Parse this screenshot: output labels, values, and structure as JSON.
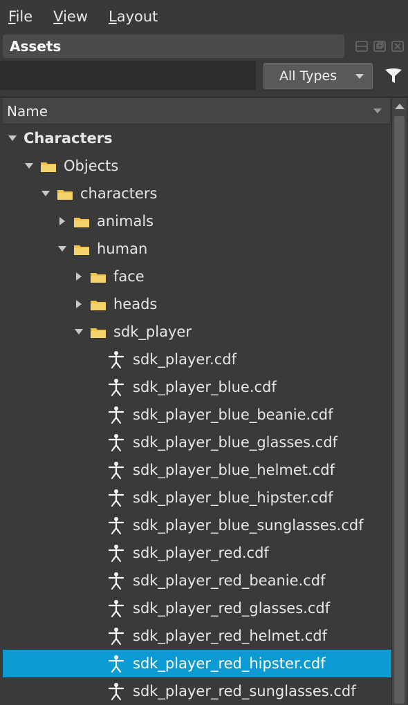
{
  "menu": {
    "file_mnemonic": "F",
    "file_rest": "ile",
    "view_mnemonic": "V",
    "view_rest": "iew",
    "layout_mnemonic": "L",
    "layout_rest": "ayout"
  },
  "panel": {
    "title": "Assets"
  },
  "search": {
    "value": "",
    "placeholder": ""
  },
  "type_filter": {
    "selected": "All Types"
  },
  "tree_header": {
    "name_label": "Name"
  },
  "colors": {
    "selection": "#0b9ad2",
    "folder": "#f3c64a",
    "character_icon": "#ffffff"
  },
  "tree": [
    {
      "label": "Characters",
      "depth": 0,
      "kind": "group",
      "expand": "down",
      "bold": true
    },
    {
      "label": "Objects",
      "depth": 1,
      "kind": "folder",
      "expand": "down"
    },
    {
      "label": "characters",
      "depth": 2,
      "kind": "folder",
      "expand": "down"
    },
    {
      "label": "animals",
      "depth": 3,
      "kind": "folder",
      "expand": "right"
    },
    {
      "label": "human",
      "depth": 3,
      "kind": "folder",
      "expand": "down"
    },
    {
      "label": "face",
      "depth": 4,
      "kind": "folder",
      "expand": "right"
    },
    {
      "label": "heads",
      "depth": 4,
      "kind": "folder",
      "expand": "right"
    },
    {
      "label": "sdk_player",
      "depth": 4,
      "kind": "folder",
      "expand": "down"
    },
    {
      "label": "sdk_player.cdf",
      "depth": 5,
      "kind": "character-file",
      "expand": "none"
    },
    {
      "label": "sdk_player_blue.cdf",
      "depth": 5,
      "kind": "character-file",
      "expand": "none"
    },
    {
      "label": "sdk_player_blue_beanie.cdf",
      "depth": 5,
      "kind": "character-file",
      "expand": "none"
    },
    {
      "label": "sdk_player_blue_glasses.cdf",
      "depth": 5,
      "kind": "character-file",
      "expand": "none"
    },
    {
      "label": "sdk_player_blue_helmet.cdf",
      "depth": 5,
      "kind": "character-file",
      "expand": "none"
    },
    {
      "label": "sdk_player_blue_hipster.cdf",
      "depth": 5,
      "kind": "character-file",
      "expand": "none"
    },
    {
      "label": "sdk_player_blue_sunglasses.cdf",
      "depth": 5,
      "kind": "character-file",
      "expand": "none"
    },
    {
      "label": "sdk_player_red.cdf",
      "depth": 5,
      "kind": "character-file",
      "expand": "none"
    },
    {
      "label": "sdk_player_red_beanie.cdf",
      "depth": 5,
      "kind": "character-file",
      "expand": "none"
    },
    {
      "label": "sdk_player_red_glasses.cdf",
      "depth": 5,
      "kind": "character-file",
      "expand": "none"
    },
    {
      "label": "sdk_player_red_helmet.cdf",
      "depth": 5,
      "kind": "character-file",
      "expand": "none"
    },
    {
      "label": "sdk_player_red_hipster.cdf",
      "depth": 5,
      "kind": "character-file",
      "expand": "none",
      "selected": true
    },
    {
      "label": "sdk_player_red_sunglasses.cdf",
      "depth": 5,
      "kind": "character-file",
      "expand": "none"
    }
  ]
}
